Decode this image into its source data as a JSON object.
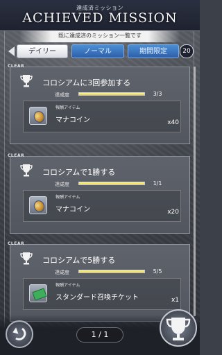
{
  "header": {
    "subtitle": "達成済ミッション",
    "title": "ACHIEVED MISSION",
    "description": "既に達成済のミッション一覧です"
  },
  "tabs": [
    {
      "label": "デイリー"
    },
    {
      "label": "ノーマル"
    },
    {
      "label": "期間限定"
    }
  ],
  "badge": {
    "count": "20"
  },
  "missions": [
    {
      "clear_label": "CLEAR",
      "title": "コロシアムに3回参加する",
      "progress_label": "達成度",
      "progress_text": "3/3",
      "progress_fraction": 1.0,
      "reward_label": "報酬アイテム",
      "reward_name": "マナコイン",
      "reward_qty": "x40",
      "reward_icon": "mana-coin-icon"
    },
    {
      "clear_label": "CLEAR",
      "title": "コロシアムで1勝する",
      "progress_label": "達成度",
      "progress_text": "1/1",
      "progress_fraction": 1.0,
      "reward_label": "報酬アイテム",
      "reward_name": "マナコイン",
      "reward_qty": "x20",
      "reward_icon": "mana-coin-icon"
    },
    {
      "clear_label": "CLEAR",
      "title": "コロシアムで5勝する",
      "progress_label": "達成度",
      "progress_text": "5/5",
      "progress_fraction": 1.0,
      "reward_label": "報酬アイテム",
      "reward_name": "スタンダード召喚チケット",
      "reward_qty": "x1",
      "reward_icon": "summon-ticket-icon"
    }
  ],
  "pager": {
    "text": "1 / 1"
  },
  "footer": {
    "back_icon": "back-icon",
    "trophy_icon": "trophy-icon"
  },
  "colors": {
    "accent_blue": "#2e5ea8",
    "progress_fill": "#e8d23a"
  }
}
